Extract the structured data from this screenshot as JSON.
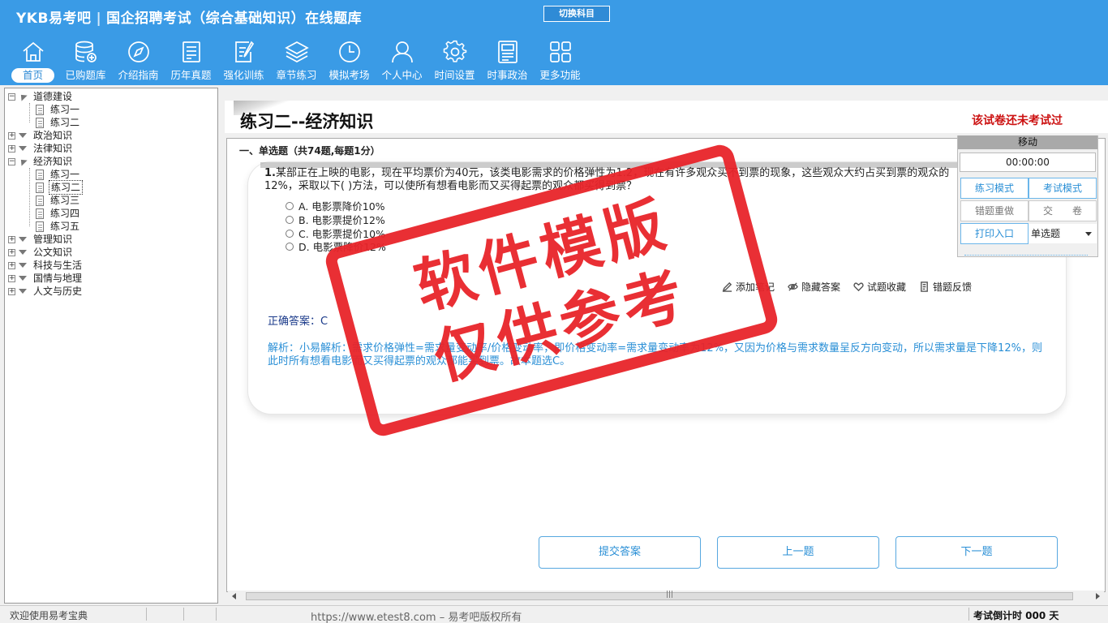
{
  "header": {
    "logo": "YKB易考吧",
    "title": "国企招聘考试（综合基础知识）在线题库",
    "switch_label": "切换科目",
    "nav": [
      {
        "label": "首页",
        "icon": "home-icon"
      },
      {
        "label": "已购题库",
        "icon": "database-icon"
      },
      {
        "label": "介绍指南",
        "icon": "compass-icon"
      },
      {
        "label": "历年真题",
        "icon": "document-list-icon"
      },
      {
        "label": "强化训练",
        "icon": "edit-icon"
      },
      {
        "label": "章节练习",
        "icon": "layers-icon"
      },
      {
        "label": "模拟考场",
        "icon": "clock-icon"
      },
      {
        "label": "个人中心",
        "icon": "user-icon"
      },
      {
        "label": "时间设置",
        "icon": "gear-icon"
      },
      {
        "label": "时事政治",
        "icon": "newspaper-icon"
      },
      {
        "label": "更多功能",
        "icon": "grid-icon"
      }
    ]
  },
  "tree": {
    "nodes": [
      {
        "label": "道德建设",
        "level": 0,
        "expanded": true
      },
      {
        "label": "练习一",
        "level": 1
      },
      {
        "label": "练习二",
        "level": 1
      },
      {
        "label": "政治知识",
        "level": 0,
        "expanded": false
      },
      {
        "label": "法律知识",
        "level": 0,
        "expanded": false
      },
      {
        "label": "经济知识",
        "level": 0,
        "expanded": true
      },
      {
        "label": "练习一",
        "level": 1
      },
      {
        "label": "练习二",
        "level": 1,
        "selected": true
      },
      {
        "label": "练习三",
        "level": 1
      },
      {
        "label": "练习四",
        "level": 1
      },
      {
        "label": "练习五",
        "level": 1
      },
      {
        "label": "管理知识",
        "level": 0,
        "expanded": false
      },
      {
        "label": "公文知识",
        "level": 0,
        "expanded": false
      },
      {
        "label": "科技与生活",
        "level": 0,
        "expanded": false
      },
      {
        "label": "国情与地理",
        "level": 0,
        "expanded": false
      },
      {
        "label": "人文与历史",
        "level": 0,
        "expanded": false
      }
    ]
  },
  "exam": {
    "title": "练习二--经济知识",
    "status": "该试卷还未考试过",
    "section": "一、单选题（共74题,每题1分）",
    "question_number": "1.",
    "question_text": "某部正在上映的电影，现在平均票价为40元，该类电影需求的价格弹性为1.2，现在有许多观众买不到票的现象，这些观众大约占买到票的观众的12%，采取以下( )方法，可以使所有想看电影而又买得起票的观众都买得到票？",
    "options": [
      "A. 电影票降价10%",
      "B. 电影票提价12%",
      "C. 电影票提价10%",
      "D. 电影票降价12%"
    ],
    "tools": [
      {
        "label": "添加笔记",
        "icon": "pencil-icon"
      },
      {
        "label": "隐藏答案",
        "icon": "eye-icon"
      },
      {
        "label": "试题收藏",
        "icon": "heart-icon"
      },
      {
        "label": "错题反馈",
        "icon": "feedback-icon"
      }
    ],
    "answer": "正确答案：C",
    "analysis": "解析：小易解析：需求价格弹性=需求量变动率/价格变动率，即价格变动率=需求量变动率为12%，又因为价格与需求数量呈反方向变动，所以需求量是下降12%，则此时所有想看电影而又买得起票的观众都能买到票。故本题选C。"
  },
  "panel": {
    "header": "移动",
    "timer": "00:00:00",
    "practice_mode": "练习模式",
    "exam_mode": "考试模式",
    "redo_wrong": "错题重做",
    "submit_paper": "交　　卷",
    "print_entry": "打印入口",
    "question_type": "单选题"
  },
  "buttons": {
    "submit": "提交答案",
    "prev": "上一题",
    "next": "下一题"
  },
  "statusbar": {
    "welcome": "欢迎使用易考宝典",
    "copyright": "https://www.etest8.com – 易考吧版权所有",
    "countdown": "考试倒计时 000 天"
  },
  "watermark": {
    "line1": "软件模版",
    "line2": "仅供参考"
  },
  "colors": {
    "header_bg": "#3a9be6",
    "accent_blue": "#2a8fd6",
    "status_red": "#cc1111",
    "stamp_red": "#e8242a"
  }
}
